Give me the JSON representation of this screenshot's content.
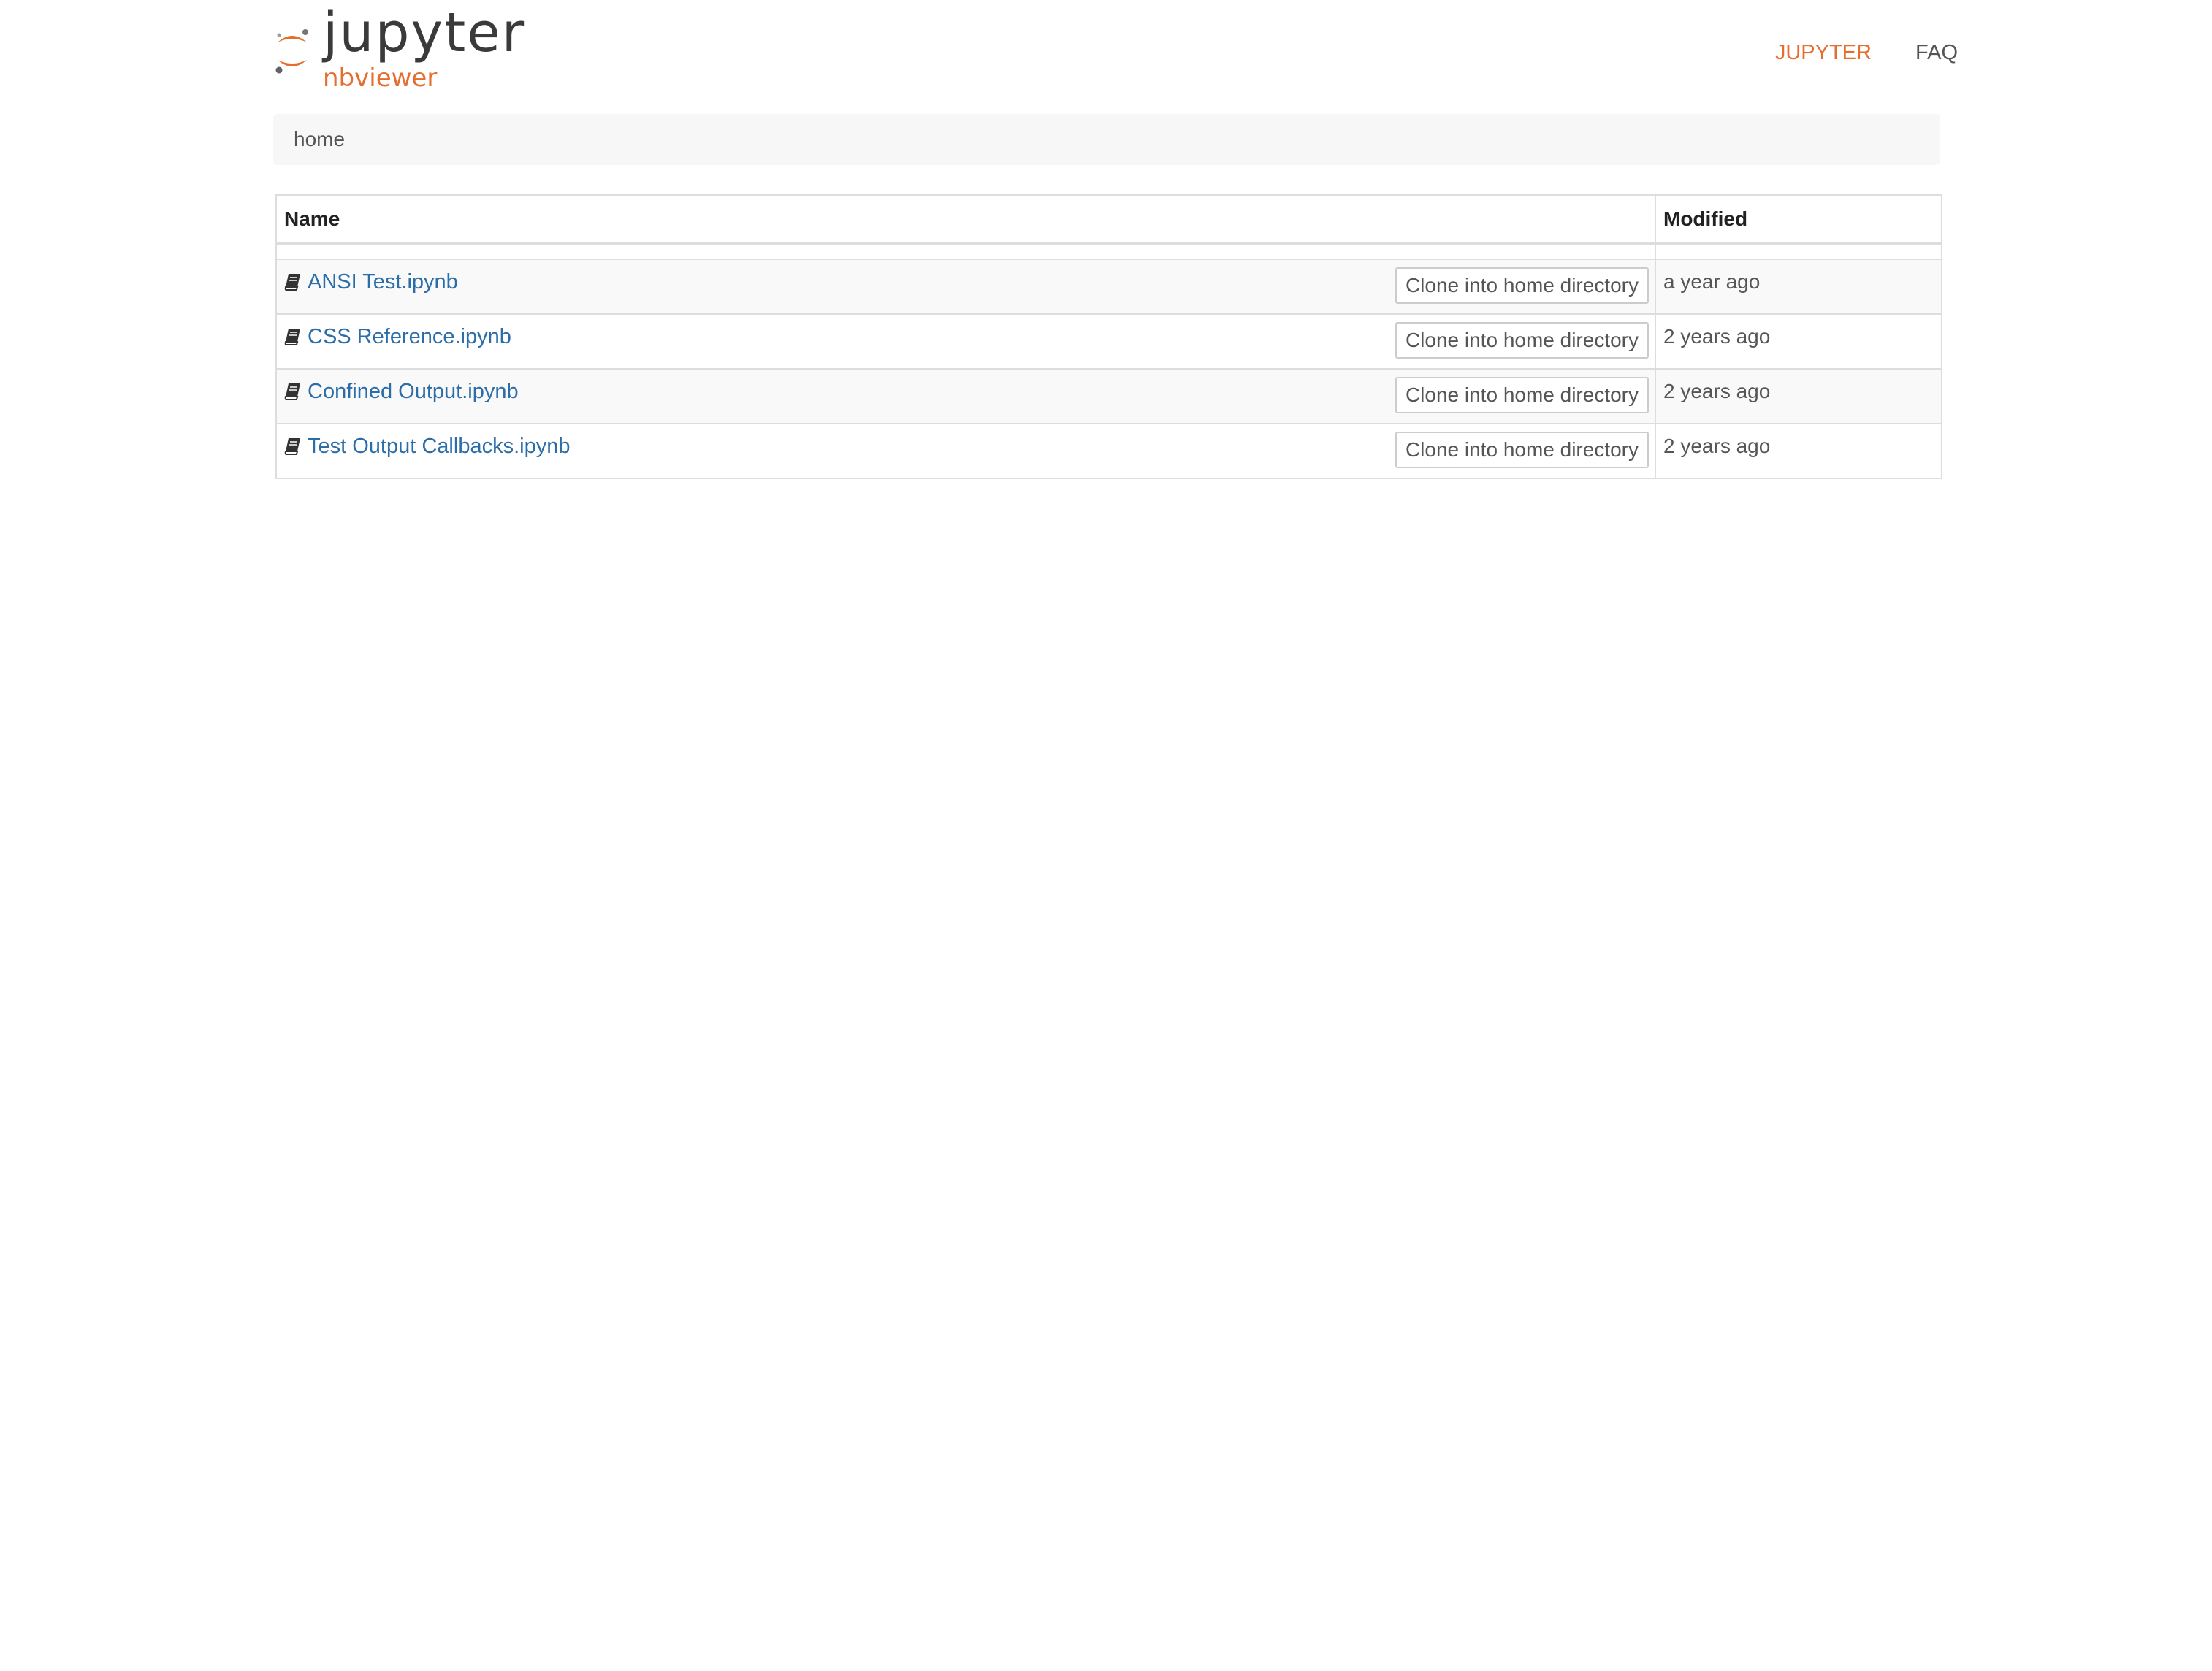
{
  "brand": {
    "wordmark": "jupyter",
    "subtitle": "nbviewer",
    "accent_color": "#e46e2e",
    "logo_icon": "jupyter-logo-icon"
  },
  "nav": {
    "items": [
      {
        "label": "JUPYTER",
        "color": "#e46e2e"
      },
      {
        "label": "FAQ",
        "color": "#555555"
      }
    ]
  },
  "breadcrumb": {
    "items": [
      "home"
    ]
  },
  "table": {
    "columns": [
      "Name",
      "Modified"
    ],
    "rows": [
      {
        "icon": "book-icon",
        "name": "ANSI Test.ipynb",
        "action": "Clone into home directory",
        "modified": "a year ago"
      },
      {
        "icon": "book-icon",
        "name": "CSS Reference.ipynb",
        "action": "Clone into home directory",
        "modified": "2 years ago"
      },
      {
        "icon": "book-icon",
        "name": "Confined Output.ipynb",
        "action": "Clone into home directory",
        "modified": "2 years ago"
      },
      {
        "icon": "book-icon",
        "name": "Test Output Callbacks.ipynb",
        "action": "Clone into home directory",
        "modified": "2 years ago"
      }
    ]
  }
}
